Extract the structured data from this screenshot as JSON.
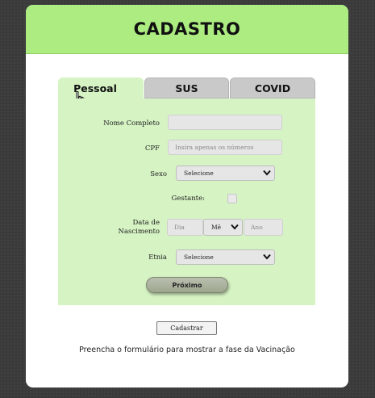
{
  "header": {
    "title": "CADASTRO"
  },
  "tabs": [
    {
      "label": "Pessoal",
      "active": true
    },
    {
      "label": "SUS",
      "active": false
    },
    {
      "label": "COVID",
      "active": false
    }
  ],
  "form": {
    "nome": {
      "label": "Nome Completo",
      "value": ""
    },
    "cpf": {
      "label": "CPF",
      "placeholder": "Insira apenas os números"
    },
    "sexo": {
      "label": "Sexo",
      "selected": "Selecione"
    },
    "gestante": {
      "label": "Gestante:",
      "checked": false
    },
    "nascimento": {
      "label_line1": "Data de",
      "label_line2": "Nascimento",
      "dia_placeholder": "Dia",
      "mes_selected": "Mê",
      "ano_placeholder": "Ano"
    },
    "etnia": {
      "label": "Etnia",
      "selected": "Selecione"
    },
    "next_label": "Próximo"
  },
  "submit_label": "Cadastrar",
  "footer_text": "Preencha o formulário para mostrar a fase da Vacinação",
  "colors": {
    "header_bg": "#acec80",
    "panel_bg": "#d6f3c4",
    "inactive_tab_bg": "#c9c9c9"
  }
}
